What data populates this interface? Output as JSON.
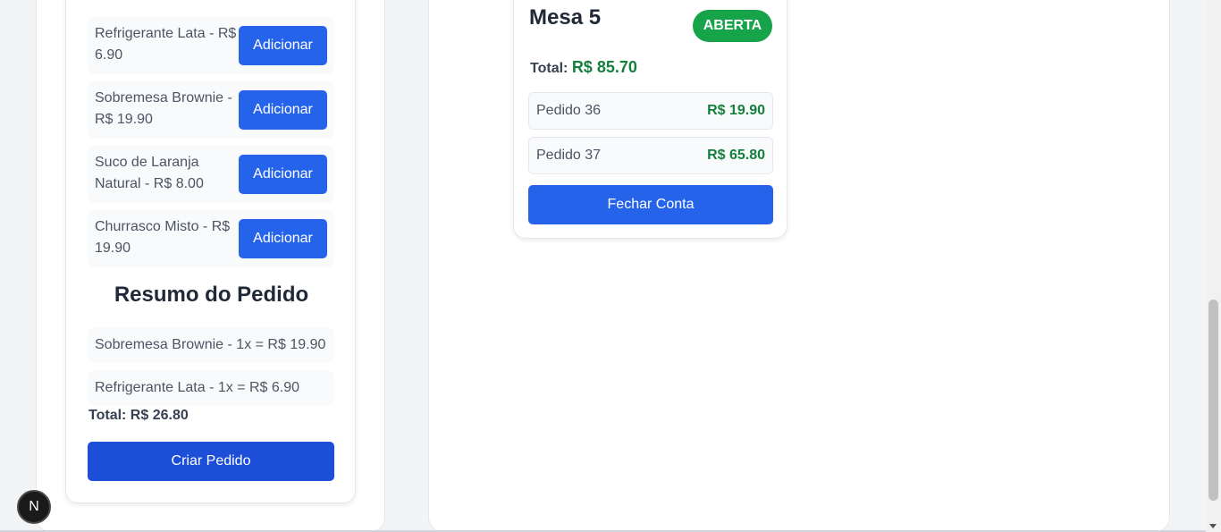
{
  "menu": {
    "items": [
      {
        "label": "Refrigerante Lata - R$ 6.90",
        "button": "Adicionar"
      },
      {
        "label": "Sobremesa Brownie - R$ 19.90",
        "button": "Adicionar"
      },
      {
        "label": "Suco de Laranja Natural - R$ 8.00",
        "button": "Adicionar"
      },
      {
        "label": "Churrasco Misto - R$ 19.90",
        "button": "Adicionar"
      }
    ]
  },
  "summary": {
    "title": "Resumo do Pedido",
    "items": [
      "Sobremesa Brownie - 1x = R$ 19.90",
      "Refrigerante Lata - 1x = R$ 6.90"
    ],
    "total": "Total: R$ 26.80",
    "create_button": "Criar Pedido"
  },
  "mesa": {
    "title": "Mesa 5",
    "status": "ABERTA",
    "status_color": "#16a34a",
    "total_label": "Total:",
    "total_value": "R$ 85.70",
    "orders": [
      {
        "name": "Pedido 36",
        "price": "R$ 19.90"
      },
      {
        "name": "Pedido 37",
        "price": "R$ 65.80"
      }
    ],
    "close_button": "Fechar Conta"
  },
  "next_indicator": {
    "label": "N",
    "icon": "nextjs-logo-icon"
  },
  "colors": {
    "primary": "#2563eb",
    "primary_dark": "#1d4ed8",
    "success": "#15803d"
  }
}
